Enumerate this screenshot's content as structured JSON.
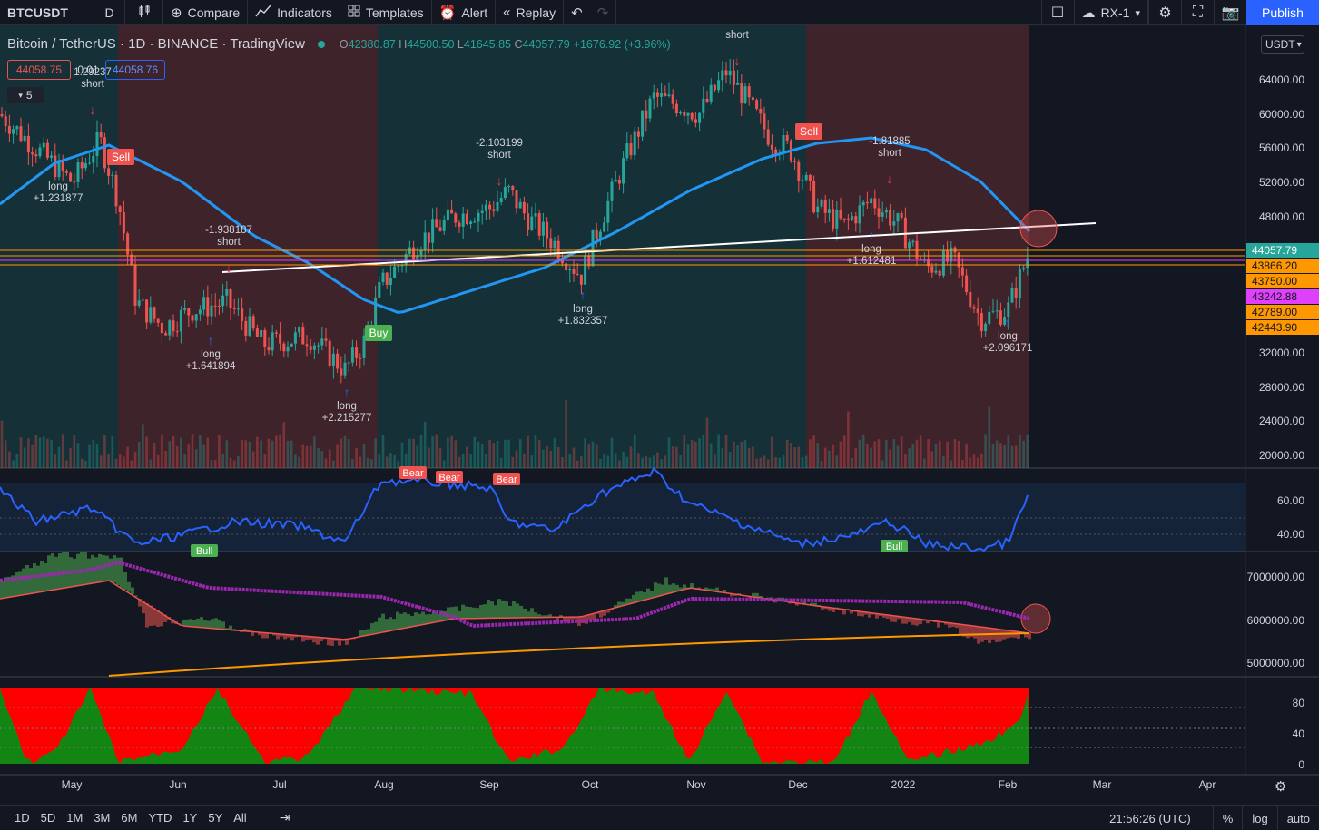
{
  "toolbar": {
    "symbol": "BTCUSDT",
    "interval": "D",
    "compare_label": "Compare",
    "indicators_label": "Indicators",
    "templates_label": "Templates",
    "alert_label": "Alert",
    "replay_label": "Replay",
    "layout_name": "RX-1",
    "publish_label": "Publish",
    "icons": [
      "candles-icon",
      "plus-circle-icon",
      "indicators-icon",
      "templates-icon",
      "alarm-clock-icon",
      "replay-icon",
      "undo-icon",
      "redo-icon",
      "layout-square-icon",
      "cloud-icon",
      "gear-icon",
      "fullscreen-icon",
      "camera-icon"
    ]
  },
  "legend": {
    "title": "Bitcoin / TetherUS · 1D · BINANCE · TradingView",
    "open_label": "O",
    "open": "42380.87",
    "high_label": "H",
    "high": "44500.50",
    "low_label": "L",
    "low": "41645.85",
    "close_label": "C",
    "close": "44057.79",
    "change": "+1676.92 (+3.96%)",
    "sell_price": "44058.75",
    "spread": "0.01",
    "buy_price": "44058.76",
    "layers_count": "5"
  },
  "price_scale": {
    "currency": "USDT",
    "ticks": [
      "64000.00",
      "60000.00",
      "56000.00",
      "52000.00",
      "48000.00",
      "32000.00",
      "28000.00",
      "24000.00",
      "20000.00"
    ],
    "labels": [
      {
        "text": "44057.79",
        "color": "#26a69a"
      },
      {
        "text": "43866.20",
        "color": "#ff9800"
      },
      {
        "text": "43750.00",
        "color": "#ff9800"
      },
      {
        "text": "43242.88",
        "color": "#e040fb"
      },
      {
        "text": "42789.00",
        "color": "#ff9800"
      },
      {
        "text": "42443.90",
        "color": "#ff9800"
      }
    ]
  },
  "rsi_scale": {
    "ticks": [
      "60.00",
      "40.00"
    ]
  },
  "obv_scale": {
    "ticks": [
      "7000000.00",
      "6000000.00",
      "5000000.00"
    ]
  },
  "osc_scale": {
    "ticks": [
      "80",
      "40",
      "0"
    ]
  },
  "time_axis": {
    "labels": [
      "May",
      "Jun",
      "Jul",
      "Aug",
      "Sep",
      "Oct",
      "Nov",
      "Dec",
      "2022",
      "Feb",
      "Mar",
      "Apr"
    ]
  },
  "annotations": {
    "signals": [
      {
        "type": "sell",
        "text": "Sell"
      },
      {
        "type": "buy",
        "text": "Buy"
      },
      {
        "type": "sell",
        "text": "Sell"
      }
    ],
    "trades": [
      {
        "side": "long",
        "text": "long",
        "value": "+1.231877"
      },
      {
        "side": "short",
        "text": "short",
        "value": "1.29237"
      },
      {
        "side": "short",
        "text": "short",
        "value": "-1.938187"
      },
      {
        "side": "long",
        "text": "long",
        "value": "+1.641894"
      },
      {
        "side": "long",
        "text": "long",
        "value": "+2.215277"
      },
      {
        "side": "short",
        "text": "short",
        "value": "-2.103199"
      },
      {
        "side": "long",
        "text": "long",
        "value": "+1.832357"
      },
      {
        "side": "short",
        "text": "short",
        "value": ""
      },
      {
        "side": "short",
        "text": "short",
        "value": "-1.81885"
      },
      {
        "side": "long",
        "text": "long",
        "value": "+1.612481"
      },
      {
        "side": "long",
        "text": "long",
        "value": "+2.096171"
      }
    ],
    "divergences": [
      {
        "text": "Bear"
      },
      {
        "text": "Bear"
      },
      {
        "text": "Bear"
      },
      {
        "text": "Bull"
      },
      {
        "text": "Bull"
      }
    ]
  },
  "bottom_bar": {
    "ranges": [
      "1D",
      "5D",
      "1M",
      "3M",
      "6M",
      "YTD",
      "1Y",
      "5Y",
      "All"
    ],
    "time": "21:56:26 (UTC)",
    "percent_label": "%",
    "log_label": "log",
    "auto_label": "auto"
  },
  "colors": {
    "background": "#131722",
    "bull": "#26a69a",
    "bear": "#ef5350",
    "accent": "#2962ff",
    "ma_blue": "#2196f3",
    "obv_purple": "#9c27b0"
  }
}
